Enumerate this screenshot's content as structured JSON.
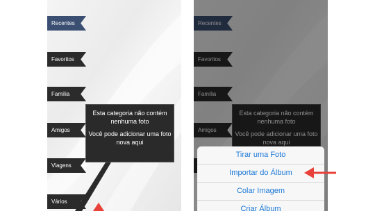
{
  "categories": [
    "Recentes",
    "Favoritos",
    "Família",
    "Amigos",
    "Viagens",
    "Vários"
  ],
  "empty_message": {
    "line1": "Esta categoria não contém nenhuma foto",
    "line2": "Você pode adicionar uma foto nova aqui"
  },
  "action_sheet": {
    "items": [
      "Tirar uma Foto",
      "Importar do Álbum",
      "Colar Imagem",
      "Criar Álbum"
    ]
  },
  "colors": {
    "active_ribbon": "#3b4f72",
    "ribbon": "#2b2b2b",
    "sheet_text": "#1a78d8",
    "highlight_arrow": "#e8413a"
  }
}
